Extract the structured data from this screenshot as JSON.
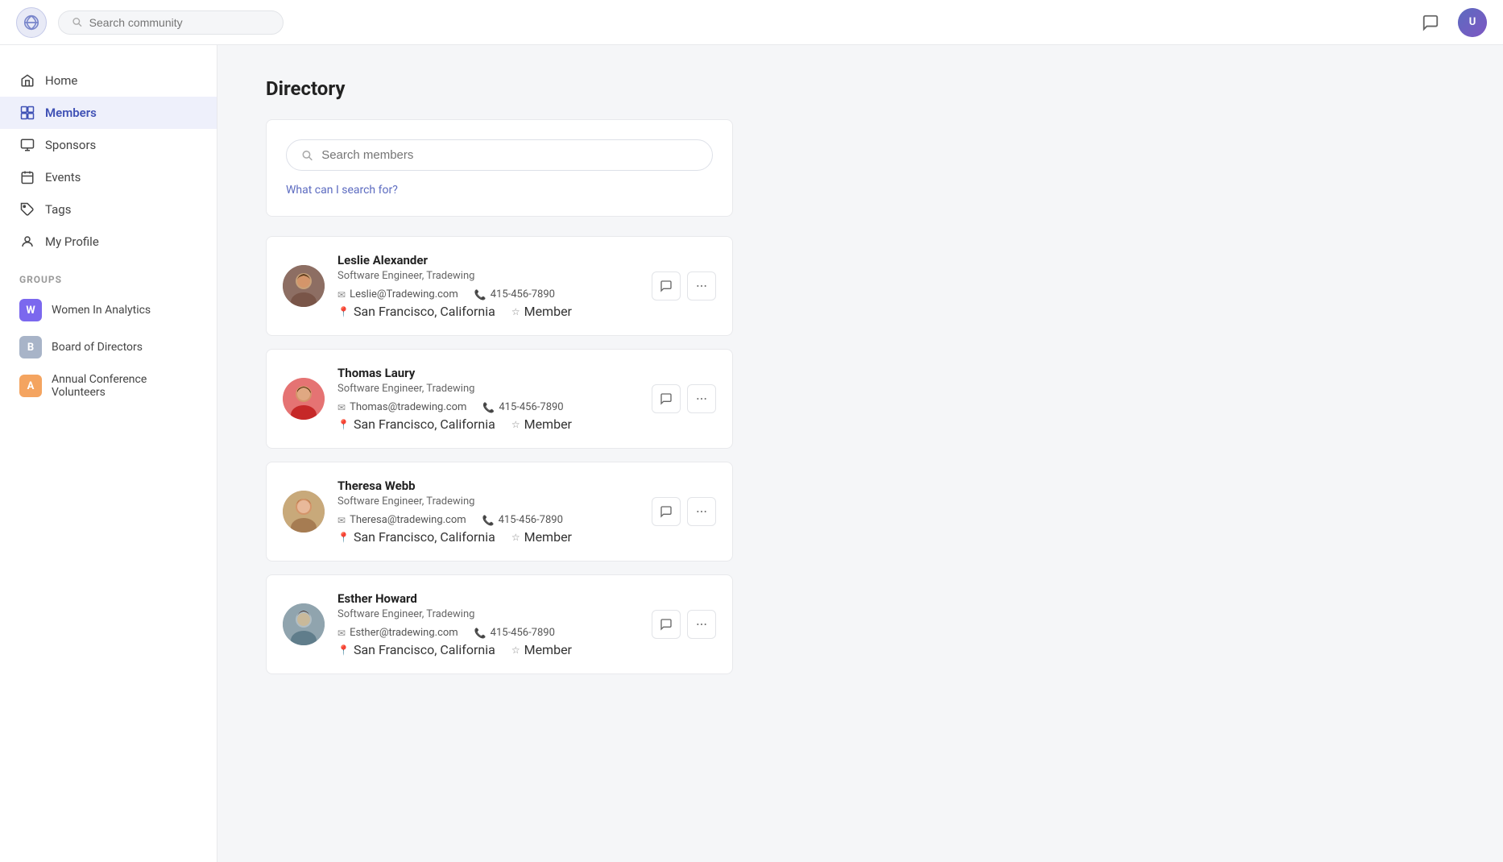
{
  "topbar": {
    "search_placeholder": "Search community",
    "user_initials": "U"
  },
  "sidebar": {
    "nav_items": [
      {
        "id": "home",
        "label": "Home",
        "icon": "home"
      },
      {
        "id": "members",
        "label": "Members",
        "icon": "members",
        "active": true
      },
      {
        "id": "sponsors",
        "label": "Sponsors",
        "icon": "sponsors"
      },
      {
        "id": "events",
        "label": "Events",
        "icon": "events"
      },
      {
        "id": "tags",
        "label": "Tags",
        "icon": "tags"
      },
      {
        "id": "myprofile",
        "label": "My Profile",
        "icon": "person"
      }
    ],
    "groups_label": "Groups",
    "groups": [
      {
        "id": "wia",
        "label": "Women In Analytics",
        "color": "#7b68ee",
        "letter": "W"
      },
      {
        "id": "bod",
        "label": "Board of Directors",
        "color": "#a8b4c8",
        "letter": "B"
      },
      {
        "id": "acv",
        "label": "Annual Conference Volunteers",
        "color": "#f4a460",
        "letter": "A"
      }
    ]
  },
  "main": {
    "title": "Directory",
    "search": {
      "placeholder": "Search members",
      "hint": "What can I search for?"
    },
    "members": [
      {
        "id": "leslie",
        "name": "Leslie Alexander",
        "title": "Software Engineer, Tradewing",
        "email": "Leslie@Tradewing.com",
        "phone": "415-456-7890",
        "location": "San Francisco, California",
        "role": "Member",
        "avatar_emoji": "👩"
      },
      {
        "id": "thomas",
        "name": "Thomas Laury",
        "title": "Software Engineer, Tradewing",
        "email": "Thomas@tradewing.com",
        "phone": "415-456-7890",
        "location": "San Francisco, California",
        "role": "Member",
        "avatar_emoji": "👨"
      },
      {
        "id": "theresa",
        "name": "Theresa Webb",
        "title": "Software Engineer, Tradewing",
        "email": "Theresa@tradewing.com",
        "phone": "415-456-7890",
        "location": "San Francisco, California",
        "role": "Member",
        "avatar_emoji": "👩"
      },
      {
        "id": "esther",
        "name": "Esther Howard",
        "title": "Software Engineer, Tradewing",
        "email": "Esther@tradewing.com",
        "phone": "415-456-7890",
        "location": "San Francisco, California",
        "role": "Member",
        "avatar_emoji": "👩"
      }
    ]
  },
  "icons": {
    "home": "⌂",
    "members": "▦",
    "sponsors": "▦",
    "events": "▦",
    "tags": "⬡",
    "person": "👤",
    "chat": "💬",
    "more": "•••",
    "search": "🔍",
    "email": "✉",
    "phone": "📞",
    "location": "📍",
    "star": "☆"
  }
}
